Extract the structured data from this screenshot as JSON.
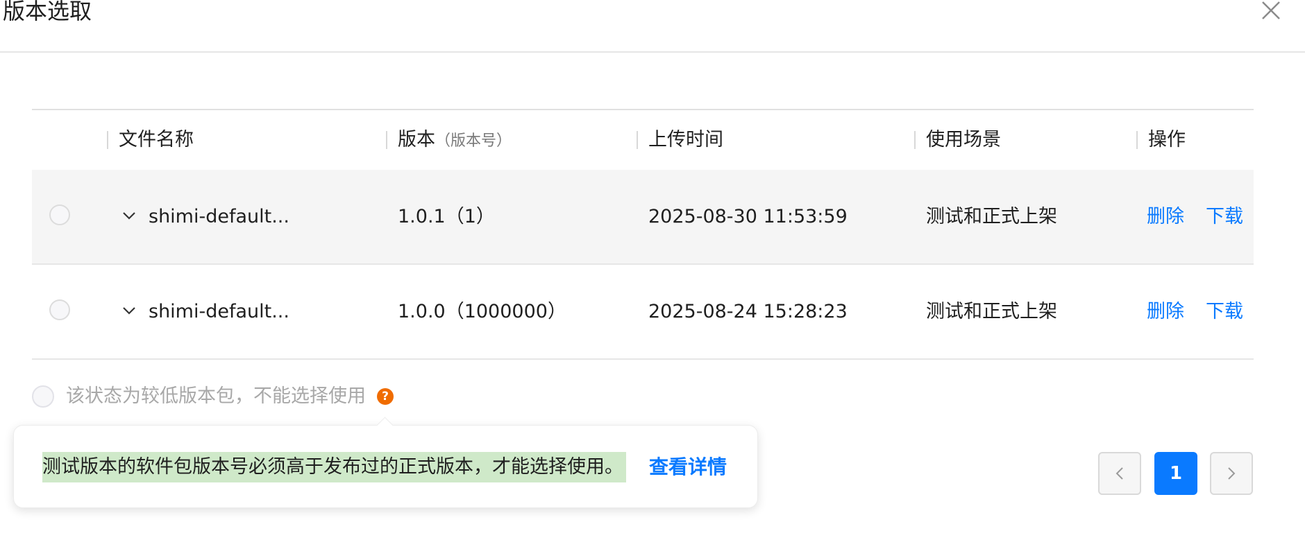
{
  "dialog": {
    "title": "版本选取"
  },
  "table": {
    "columns": {
      "file_name": "文件名称",
      "version": "版本",
      "version_sub": "（版本号）",
      "upload_time": "上传时间",
      "usage_scene": "使用场景",
      "actions": "操作"
    },
    "rows": [
      {
        "file_name": "shimi-default...",
        "version": "1.0.1（1）",
        "upload_time": "2025-08-30 11:53:59",
        "usage_scene": "测试和正式上架",
        "delete_label": "删除",
        "download_label": "下载"
      },
      {
        "file_name": "shimi-default...",
        "version": "1.0.0（1000000）",
        "upload_time": "2025-08-24 15:28:23",
        "usage_scene": "测试和正式上架",
        "delete_label": "删除",
        "download_label": "下载"
      }
    ]
  },
  "legend": {
    "text": "该状态为较低版本包，不能选择使用",
    "help_symbol": "?"
  },
  "tooltip": {
    "text": "测试版本的软件包版本号必须高于发布过的正式版本，才能选择使用。",
    "link": "查看详情"
  },
  "pagination": {
    "current_page": "1"
  },
  "colors": {
    "accent": "#0a7aff",
    "help_icon": "#f06c00",
    "highlight": "#cfe9c9",
    "row_hover": "#f5f5f5"
  },
  "icons": {
    "close": "close-icon",
    "expand": "chevron-down-icon",
    "prev": "chevron-left-icon",
    "next": "chevron-right-icon",
    "help": "question-icon"
  }
}
